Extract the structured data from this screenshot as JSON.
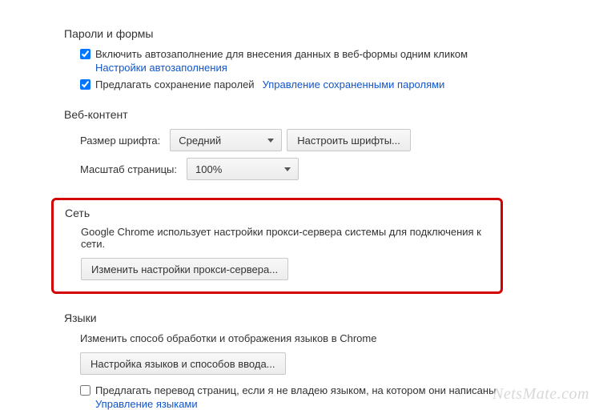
{
  "passwords_forms": {
    "title": "Пароли и формы",
    "autofill_checkbox_label": "Включить автозаполнение для внесения данных в веб-формы одним кликом",
    "autofill_settings_link": "Настройки автозаполнения",
    "save_passwords_label": "Предлагать сохранение паролей",
    "manage_passwords_link": "Управление сохраненными паролями"
  },
  "web_content": {
    "title": "Веб-контент",
    "font_size_label": "Размер шрифта:",
    "font_size_value": "Средний",
    "customize_fonts_button": "Настроить шрифты...",
    "page_zoom_label": "Масштаб страницы:",
    "page_zoom_value": "100%"
  },
  "network": {
    "title": "Сеть",
    "description": "Google Chrome использует настройки прокси-сервера системы для подключения к сети.",
    "proxy_button": "Изменить настройки прокси-сервера..."
  },
  "languages": {
    "title": "Языки",
    "description": "Изменить способ обработки и отображения языков в Chrome",
    "lang_settings_button": "Настройка языков и способов ввода...",
    "translate_checkbox_label": "Предлагать перевод страниц, если я не владею языком, на котором они написаны",
    "manage_languages_link": "Управление языками"
  },
  "watermark": "NetsMate.com"
}
